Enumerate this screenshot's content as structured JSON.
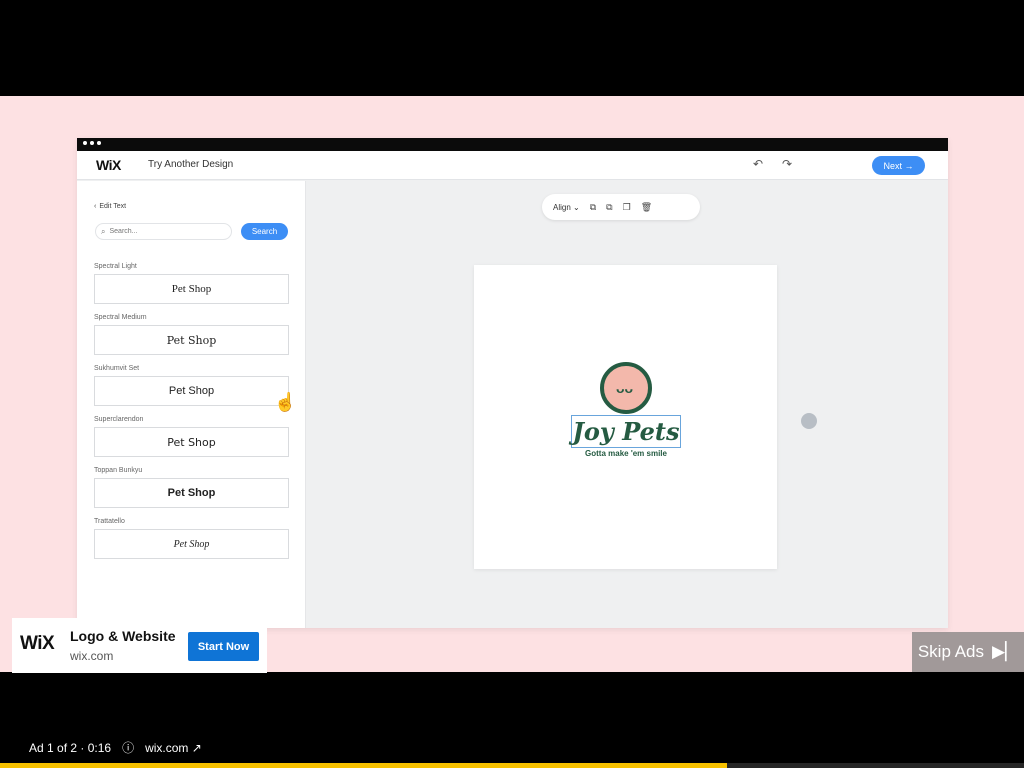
{
  "app": {
    "brand": "WiX",
    "action": "Try Another Design",
    "next": "Next →"
  },
  "toolbar": {
    "undo_icon": "undo-icon",
    "redo_icon": "redo-icon"
  },
  "sidebar": {
    "back_label": "Edit Text",
    "search_placeholder": "Search...",
    "search_button": "Search",
    "fonts": [
      {
        "name": "Spectral Light",
        "sample": "Pet Shop"
      },
      {
        "name": "Spectral Medium",
        "sample": "Pet Shop"
      },
      {
        "name": "Sukhumvit Set",
        "sample": "Pet Shop"
      },
      {
        "name": "Superclarendon",
        "sample": "Pet Shop"
      },
      {
        "name": "Toppan Bunkyu",
        "sample": "Pet Shop"
      },
      {
        "name": "Trattatello",
        "sample": "Pet Shop"
      }
    ]
  },
  "canvas": {
    "align_label": "Align",
    "logo_title": "Joy Pets",
    "logo_tagline": "Gotta make 'em smile"
  },
  "ad": {
    "brand": "WiX",
    "title": "Logo & Website",
    "domain": "wix.com",
    "cta": "Start Now",
    "skip": "Skip Ads",
    "counter": "Ad 1 of 2 · 0:16",
    "footer_domain": "wix.com"
  },
  "progress": {
    "value": 0.71
  },
  "colors": {
    "accent": "#3d8ef5",
    "logo_green": "#255b42",
    "logo_pink": "#f3b8ab",
    "ad_button": "#0f74d6",
    "progress": "#f7c100"
  }
}
